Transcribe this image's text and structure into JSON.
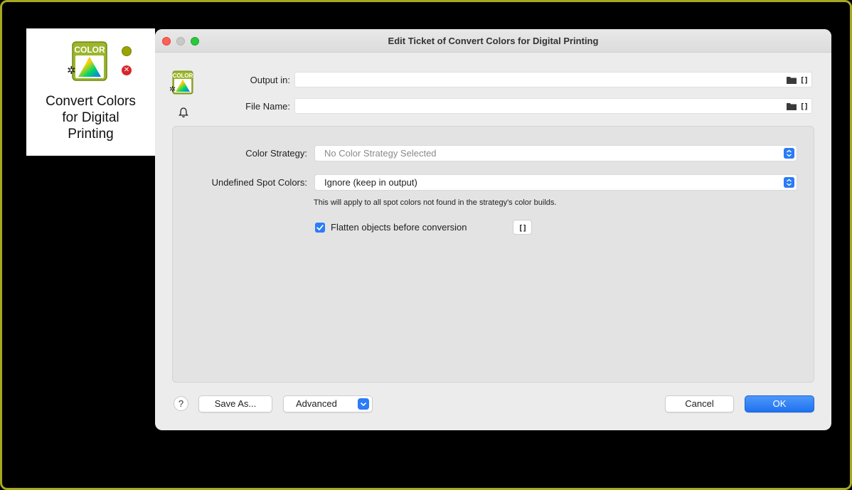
{
  "tile": {
    "icon_text": "COLOR",
    "title_line1": "Convert Colors",
    "title_line2": "for Digital",
    "title_line3": "Printing",
    "error_glyph": "✕"
  },
  "dialog": {
    "title": "Edit Ticket of Convert Colors for Digital Printing",
    "app_icon_text": "COLOR",
    "output_in_label": "Output in:",
    "file_name_label": "File Name:",
    "output_in_value": "",
    "file_name_value": "",
    "bracket_glyph": "[]"
  },
  "panel": {
    "color_strategy_label": "Color Strategy:",
    "color_strategy_value": "No Color Strategy Selected",
    "undefined_spot_label": "Undefined Spot Colors:",
    "undefined_spot_value": "Ignore (keep in output)",
    "hint": "This will apply to all spot colors not found in the strategy's color builds.",
    "flatten_label": "Flatten objects before conversion",
    "flatten_checked": true,
    "bracket_glyph": "[]"
  },
  "footer": {
    "help_label": "?",
    "save_as_label": "Save As...",
    "advanced_label": "Advanced",
    "cancel_label": "Cancel",
    "ok_label": "OK"
  },
  "colors": {
    "accent": "#2b7cf6",
    "frame": "#a7a81f",
    "icon_green": "#8ea71f"
  },
  "icons": [
    "color-icon",
    "gear-icon",
    "status-green-icon",
    "error-icon",
    "folder-icon",
    "bracket-icon",
    "bell-icon",
    "chevron-updown-icon",
    "chevron-down-icon",
    "checkmark-icon"
  ]
}
